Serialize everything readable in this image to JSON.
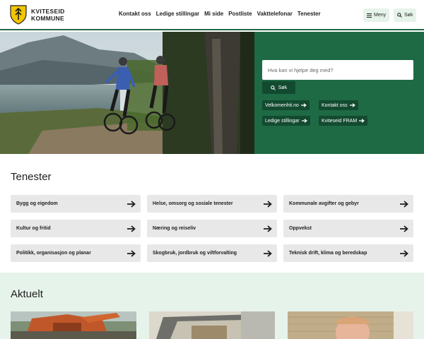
{
  "header": {
    "logo_line1": "KVITESEID",
    "logo_line2": "KOMMUNE",
    "nav": [
      "Kontakt oss",
      "Ledige stillingar",
      "Mi side",
      "Postliste",
      "Vakttelefonar",
      "Tenester"
    ],
    "menu_label": "Meny",
    "search_label": "Søk"
  },
  "hero": {
    "search_placeholder": "Hva kan vi hjelpe deg med?",
    "search_button": "Søk",
    "quick_links": [
      "Velkomenhit.no",
      "Kontakt oss",
      "Ledige stillingar",
      "Kviteseid FRAM"
    ]
  },
  "tenester": {
    "title": "Tenester",
    "items": [
      "Bygg og eigedom",
      "Helse, omsorg og sosiale tenester",
      "Kommunale avgifter og gebyr",
      "Kultur og fritid",
      "Næring og reiseliv",
      "Oppvekst",
      "Politikk, organisasjon og planar",
      "Skogbruk, jordbruk og viltforvalting",
      "Teknisk drift, klima og beredskap"
    ]
  },
  "aktuelt": {
    "title": "Aktuelt"
  },
  "colors": {
    "brand_green": "#1e6a45",
    "dark_green": "#124a30",
    "light_green": "#e6f3ea",
    "tile_gray": "#e8e8e8"
  }
}
